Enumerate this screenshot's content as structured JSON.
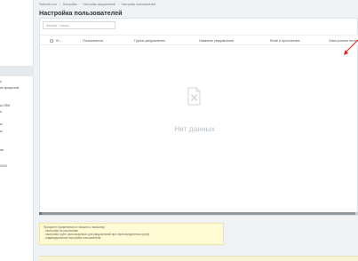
{
  "breadcrumb": [
    "Рабочий стол",
    "Настройки",
    "Настройки уведомлений",
    "Настройки пользователей"
  ],
  "page": {
    "title": "Настройка пользователей"
  },
  "sidebar": {
    "items": [
      {
        "label": ""
      },
      {
        "label": "ь"
      },
      {
        "label": "ие процессов"
      },
      {
        "label": "ы CRM"
      },
      {
        "label": "я"
      },
      {
        "label": "ы"
      },
      {
        "label": "ы"
      },
      {
        "label": "ия"
      },
      {
        "label": "ОСИ"
      },
      {
        "label": ""
      }
    ]
  },
  "filter": {
    "placeholder": "Фильтр + поиск"
  },
  "table": {
    "columns": [
      "ID",
      "Пользователь",
      "Группа уведомления",
      "Название уведомления",
      "Email и приложения",
      "Электронная почта"
    ]
  },
  "empty": {
    "text": "Нет данных"
  },
  "notice": {
    "lines": [
      "Приоритет применения от низшего к высшему:",
      "  - настройки по умолчанию",
      "  - настройки групп (используемых для уведомлений при переопределении групп)",
      "  - индивидуальные настройки пользователя"
    ]
  },
  "colors": {
    "accent": "#e0231c",
    "notice_bg": "#fffbd5",
    "background": "#eef2f4"
  }
}
